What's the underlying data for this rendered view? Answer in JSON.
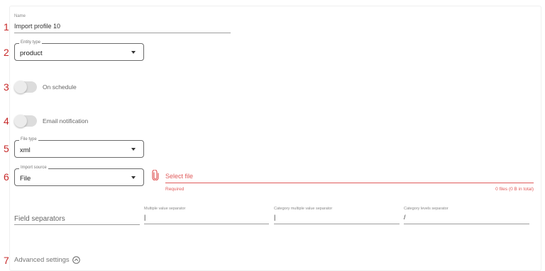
{
  "markers": [
    "1",
    "2",
    "3",
    "4",
    "5",
    "6",
    "7"
  ],
  "name_field": {
    "label": "Name",
    "value": "Import profile 10"
  },
  "entity_type": {
    "label": "Entity type",
    "value": "product"
  },
  "on_schedule": {
    "label": "On schedule",
    "checked": false
  },
  "email_notification": {
    "label": "Email notification",
    "checked": false
  },
  "file_type": {
    "label": "File type",
    "value": "xml"
  },
  "import_source": {
    "label": "Import source",
    "value": "File"
  },
  "file_picker": {
    "icon": "paperclip-icon",
    "placeholder": "Select file",
    "helper": "Required",
    "summary": "0 files (0 B in total)",
    "accent": "#e05a5a"
  },
  "separators": {
    "title": "Field separators",
    "multiple_value": {
      "label": "Multiple value separator",
      "value": "|"
    },
    "category_multiple_value": {
      "label": "Category multiple value separator",
      "value": "|"
    },
    "category_levels": {
      "label": "Category levels separator",
      "value": "/"
    }
  },
  "advanced": {
    "label": "Advanced settings",
    "icon": "chevron-up-circle-icon"
  }
}
